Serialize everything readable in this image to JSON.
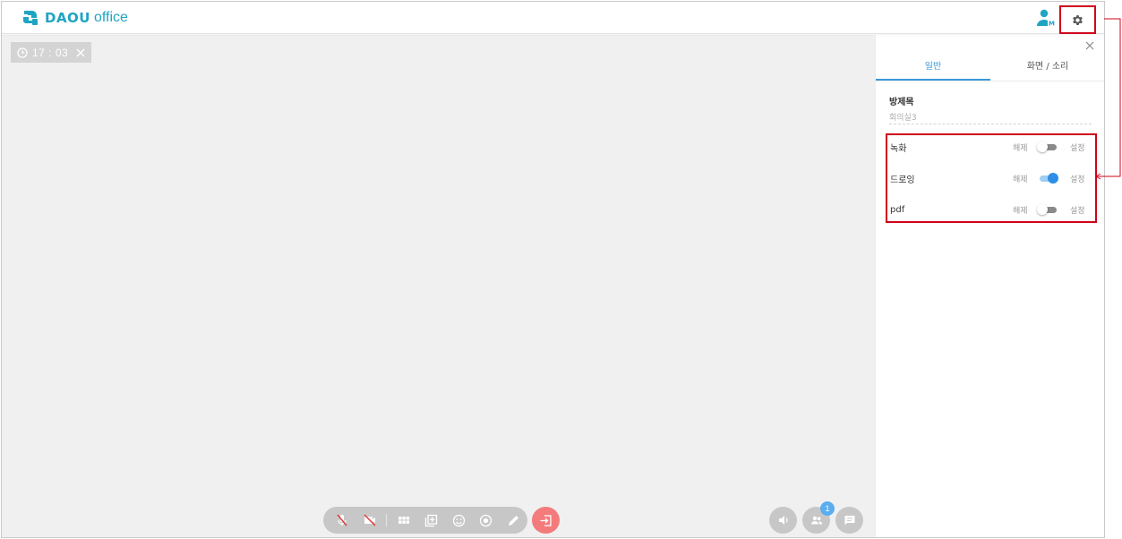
{
  "header": {
    "logo_brand": "DAOU",
    "logo_product": "office"
  },
  "stage": {
    "timer": "17 : 03",
    "participant_count": "1"
  },
  "panel": {
    "tabs": [
      {
        "label": "일반",
        "active": true
      },
      {
        "label": "화면 / 소리",
        "active": false
      }
    ],
    "room_title_label": "방제목",
    "room_title_value": "회의실3",
    "settings": [
      {
        "name": "녹화",
        "off_label": "해제",
        "on_label": "설정",
        "enabled": false
      },
      {
        "name": "드로잉",
        "off_label": "해제",
        "on_label": "설정",
        "enabled": true
      },
      {
        "name": "pdf",
        "off_label": "해제",
        "on_label": "설정",
        "enabled": false
      }
    ]
  },
  "colors": {
    "brand": "#1fa4c2",
    "accent_blue": "#3a9ad9",
    "exit_red": "#f47b7b",
    "highlight_red": "#d0021b",
    "badge_blue": "#5aaef0"
  },
  "icons": {
    "toolbar": [
      "mic-off-icon",
      "camera-off-icon",
      "grid-layout-icon",
      "screen-share-icon",
      "emoji-icon",
      "record-icon",
      "pen-icon"
    ],
    "exit": "exit-icon",
    "right": [
      "speaker-icon",
      "participants-icon",
      "chat-icon"
    ]
  }
}
